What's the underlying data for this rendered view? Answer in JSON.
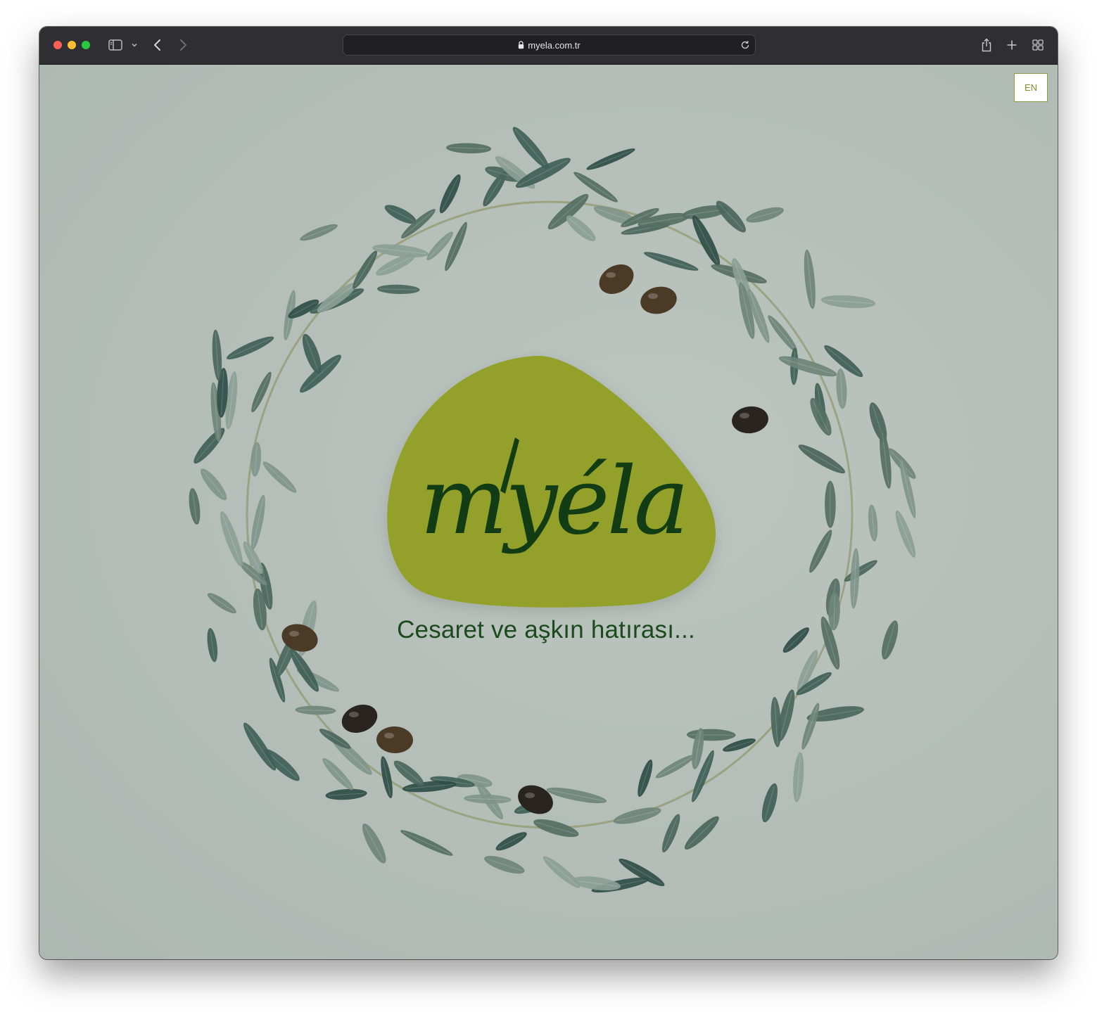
{
  "browser": {
    "url": "myela.com.tr",
    "traffic_lights": {
      "close": "#fe5f57",
      "minimize": "#febc2e",
      "maximize": "#28c840"
    },
    "icons": [
      "sidebar-icon",
      "chevron-down-icon",
      "back-icon",
      "forward-icon",
      "lock-icon",
      "reload-icon",
      "share-icon",
      "new-tab-icon",
      "tab-overview-icon"
    ]
  },
  "page": {
    "language_button": "EN",
    "logo": {
      "wordmark": "myéla",
      "blob_color": "#93a02a",
      "text_color": "#123d14"
    },
    "tagline": "Cesaret ve aşkın hatırası...",
    "background_color": "#b5bfba",
    "decoration": "olive-wreath"
  }
}
